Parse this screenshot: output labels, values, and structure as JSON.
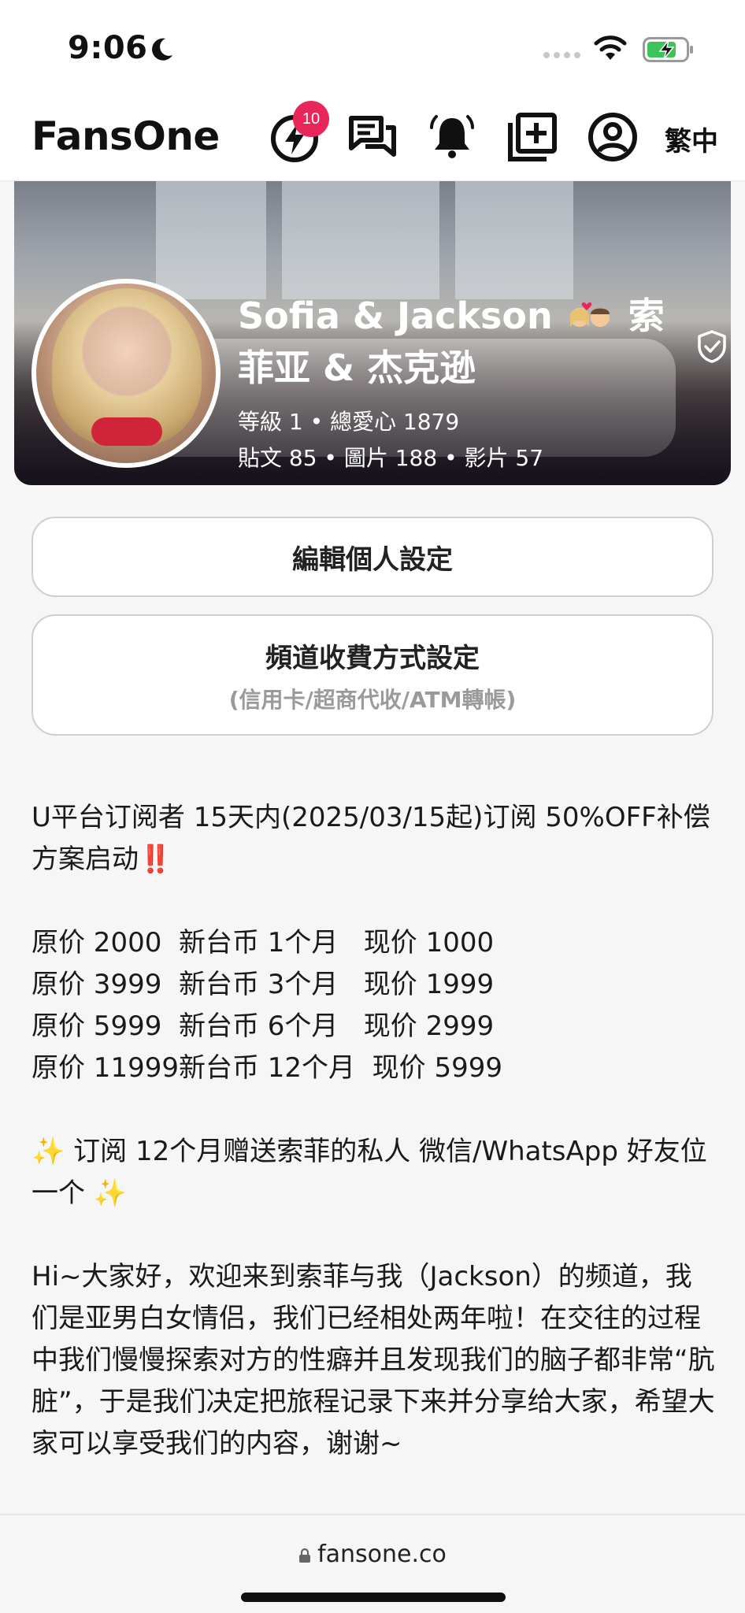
{
  "status_bar": {
    "time": "9:06",
    "icons": [
      "moon-icon",
      "cellular-icon",
      "wifi-icon",
      "battery-charging-icon"
    ]
  },
  "nav": {
    "logo": "FansOne",
    "badge_count": "10",
    "lang": "繁中",
    "icons": [
      "lightning-icon",
      "chat-icon",
      "bell-icon",
      "add-post-icon",
      "account-icon"
    ]
  },
  "profile": {
    "name": "Sofia & Jackson",
    "name_cn": "索菲亚 & 杰克逊",
    "stats_line1": "等級 1 • 總愛心 1879",
    "stats_line2": "貼文 85 • 圖片 188 • 影片 57"
  },
  "buttons": {
    "edit_profile": "編輯個人設定",
    "payment_settings": "頻道收費方式設定",
    "payment_settings_sub": "(信用卡/超商代收/ATM轉帳)"
  },
  "description": {
    "line1": "U平台订阅者 15天内(2025/03/15起)订阅 50%OFF补偿方案启动‼️",
    "price_lines": [
      "原价 2000  新台币 1个月   现价 1000",
      "原价 3999  新台币 3个月   现价 1999",
      "原价 5999  新台币 6个月   现价 2999",
      "原价 11999新台币 12个月  现价 5999"
    ],
    "bonus": "✨ 订阅 12个月赠送索菲的私人 微信/WhatsApp 好友位一个 ✨",
    "intro": "Hi~大家好，欢迎来到索菲与我（Jackson）的频道，我们是亚男白女情侣，我们已经相处两年啦！在交往的过程中我们慢慢探索对方的性癖并且发现我们的脑子都非常“肮脏”，于是我们决定把旅程记录下来并分享给大家，希望大家可以享受我们的内容，谢谢~"
  },
  "footer": {
    "url": "fansone.co"
  }
}
